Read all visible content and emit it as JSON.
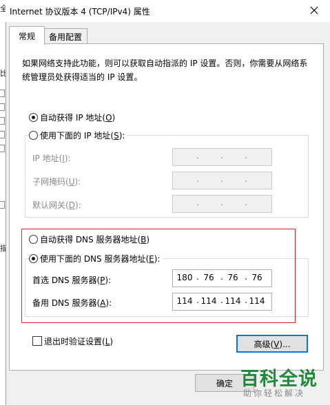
{
  "window": {
    "title": "Internet 协议版本 4 (TCP/IPv4) 属性"
  },
  "background_window": {
    "fragment_1": "全",
    "fragment_2": "比",
    "fragment_3": "描"
  },
  "tabs": [
    {
      "label": "常规",
      "active": true
    },
    {
      "label": "备用配置",
      "active": false
    }
  ],
  "description": "如果网络支持此功能，则可以获取自动指派的 IP 设置。否则，你需要从网络系统管理员处获得适当的 IP 设置。",
  "ip_section": {
    "auto_option": {
      "label": "自动获得 IP 地址(",
      "key": "O",
      "suffix": ")",
      "selected": true
    },
    "manual_option": {
      "label": "使用下面的 IP 地址(",
      "key": "S",
      "suffix": "):",
      "selected": false
    },
    "fields": [
      {
        "label": "IP 地址(",
        "key": "I",
        "suffix": "):",
        "octets": [
          "",
          "",
          "",
          ""
        ],
        "enabled": false
      },
      {
        "label": "子网掩码(",
        "key": "U",
        "suffix": "):",
        "octets": [
          "",
          "",
          "",
          ""
        ],
        "enabled": false
      },
      {
        "label": "默认网关(",
        "key": "D",
        "suffix": "):",
        "octets": [
          "",
          "",
          "",
          ""
        ],
        "enabled": false
      }
    ]
  },
  "dns_section": {
    "auto_option": {
      "label": "自动获得 DNS 服务器地址(",
      "key": "B",
      "suffix": ")",
      "selected": false
    },
    "manual_option": {
      "label": "使用下面的 DNS 服务器地址(",
      "key": "E",
      "suffix": "):",
      "selected": true
    },
    "preferred": {
      "label": "首选 DNS 服务器(",
      "key": "P",
      "suffix": "):",
      "octets": [
        "180",
        "76",
        "76",
        "76"
      ]
    },
    "alternate": {
      "label": "备用 DNS 服务器(",
      "key": "A",
      "suffix": "):",
      "octets": [
        "114",
        "114",
        "114",
        "114"
      ]
    }
  },
  "validate_on_exit": {
    "label": "退出时验证设置(",
    "key": "L",
    "suffix": ")",
    "checked": false
  },
  "buttons": {
    "advanced": {
      "label": "高级(",
      "key": "V",
      "suffix": ")..."
    },
    "ok": {
      "label": "确定"
    }
  },
  "watermark": {
    "title": "百科全说",
    "subtitle": "助你轻松解决"
  },
  "colors": {
    "highlight_box": "#e0231a",
    "focus_border": "#0078d7",
    "watermark": "#1f8a3a"
  }
}
